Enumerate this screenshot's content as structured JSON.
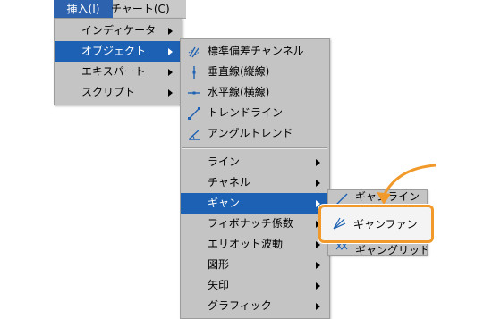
{
  "menubar": {
    "insert_label": "挿入(I)",
    "chart_label": "チャート(C)"
  },
  "menu1": {
    "items": [
      {
        "label": "インディケータ"
      },
      {
        "label": "オブジェクト"
      },
      {
        "label": "エキスパート"
      },
      {
        "label": "スクリプト"
      }
    ]
  },
  "menu2": {
    "items": [
      {
        "label": "標準偏差チャンネル",
        "icon": "std-deviation-channel-icon"
      },
      {
        "label": "垂直線(縦線)",
        "icon": "vertical-line-icon"
      },
      {
        "label": "水平線(横線)",
        "icon": "horizontal-line-icon"
      },
      {
        "label": "トレンドライン",
        "icon": "trendline-icon"
      },
      {
        "label": "アングルトレンド",
        "icon": "angle-trend-icon"
      },
      {
        "label": "ライン"
      },
      {
        "label": "チャネル"
      },
      {
        "label": "ギャン"
      },
      {
        "label": "フィボナッチ係数"
      },
      {
        "label": "エリオット波動"
      },
      {
        "label": "図形"
      },
      {
        "label": "矢印"
      },
      {
        "label": "グラフィック"
      }
    ]
  },
  "menu3": {
    "items": [
      {
        "label": "ギャンライン"
      },
      {
        "label": "ギャンファン"
      },
      {
        "label": "ギャングリッド"
      }
    ]
  },
  "highlight": {
    "label": "ギャンファン",
    "color": "#f19a2b"
  },
  "colors": {
    "selection": "#1c61b3",
    "menu_bg": "#c4c4c4"
  }
}
